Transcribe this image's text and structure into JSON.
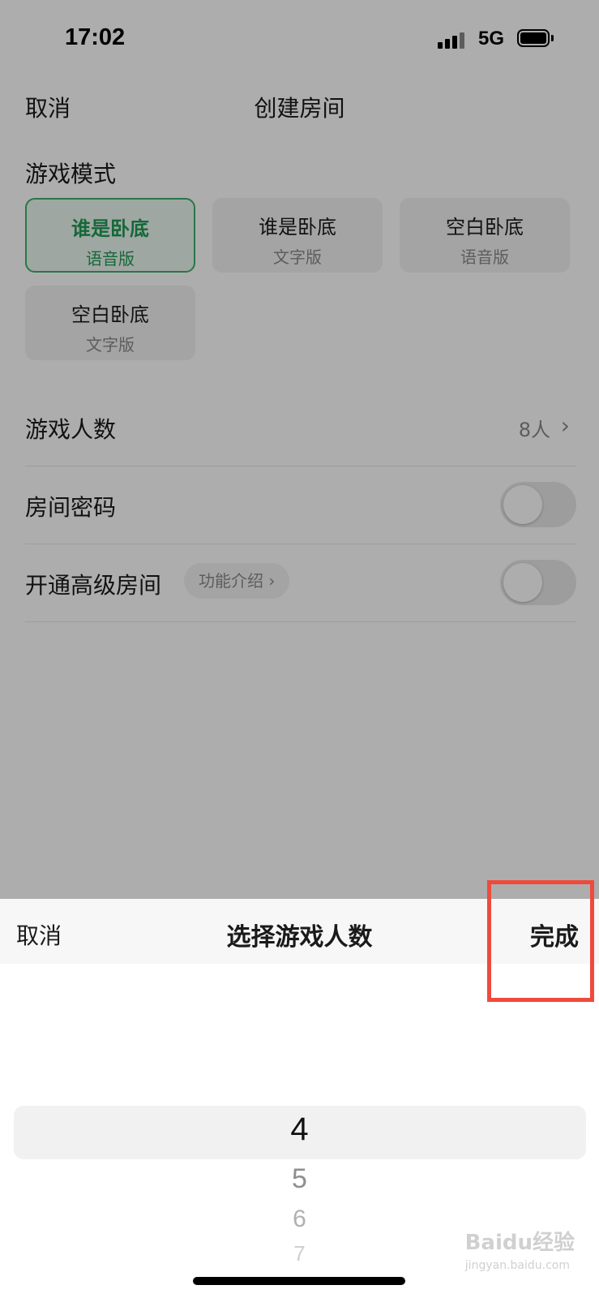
{
  "status_bar": {
    "time": "17:02",
    "network": "5G"
  },
  "page": {
    "nav": {
      "cancel_label": "取消",
      "title": "创建房间"
    },
    "game_mode": {
      "label": "游戏模式",
      "options": [
        {
          "name": "谁是卧底",
          "sub": "语音版",
          "selected": true
        },
        {
          "name": "谁是卧底",
          "sub": "文字版",
          "selected": false
        },
        {
          "name": "空白卧底",
          "sub": "语音版",
          "selected": false
        },
        {
          "name": "空白卧底",
          "sub": "文字版",
          "selected": false
        }
      ]
    },
    "player_count": {
      "label": "游戏人数",
      "value": "8人",
      "chevron": "chevron-right-icon"
    },
    "room_password": {
      "label": "房间密码",
      "toggle_on": false
    },
    "premium_room": {
      "label": "开通高级房间",
      "intro_label": "功能介绍 ›",
      "toggle_on": false
    }
  },
  "sheet": {
    "cancel_label": "取消",
    "title": "选择游戏人数",
    "done_label": "完成",
    "picker": {
      "selected": "4",
      "items": [
        "4",
        "5",
        "6",
        "7"
      ]
    }
  },
  "watermark": {
    "text": "Baidu经验",
    "sub": "jingyan.baidu.com"
  },
  "colors": {
    "accent_green": "#3bb06a",
    "highlight_red": "#ef4a3c"
  }
}
